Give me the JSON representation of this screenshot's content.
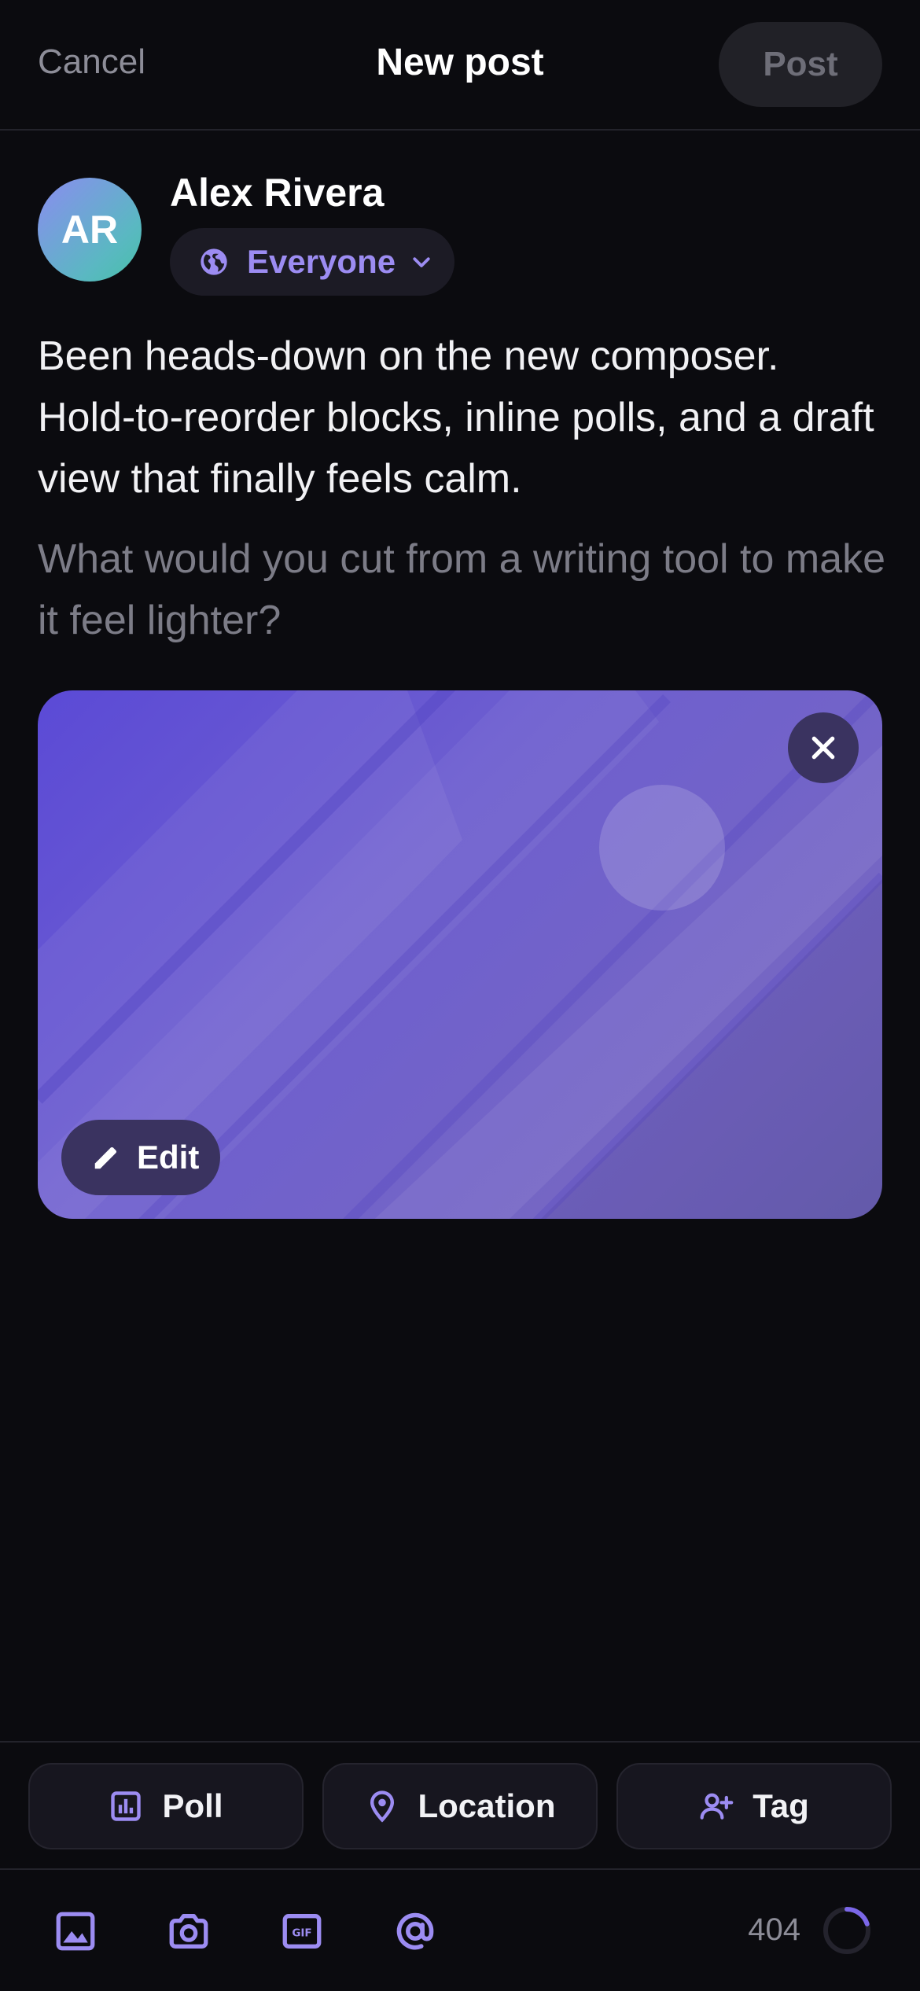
{
  "header": {
    "cancel_label": "Cancel",
    "title": "New post",
    "post_label": "Post"
  },
  "author": {
    "initials": "AR",
    "name": "Alex Rivera",
    "audience_label": "Everyone"
  },
  "composer": {
    "body_text": "Been heads-down on the new composer. Hold-to-reorder blocks, inline polls, and a draft view that finally feels calm.",
    "prompt_text": "What would you cut from a writing tool to make it feel lighter?"
  },
  "attachment": {
    "edit_label": "Edit"
  },
  "quick_actions": [
    {
      "label": "Poll",
      "icon": "poll-icon"
    },
    {
      "label": "Location",
      "icon": "location-pin-icon"
    },
    {
      "label": "Tag",
      "icon": "add-person-icon"
    }
  ],
  "toolbar": {
    "tools": [
      "image-icon",
      "camera-icon",
      "gif-icon",
      "mention-icon"
    ],
    "char_count": "404",
    "char_progress": 0.2
  },
  "colors": {
    "background": "#0b0b0f",
    "accent": "#9c8cf2",
    "surface": "#1c1b25",
    "muted_text": "#8d8d98"
  }
}
